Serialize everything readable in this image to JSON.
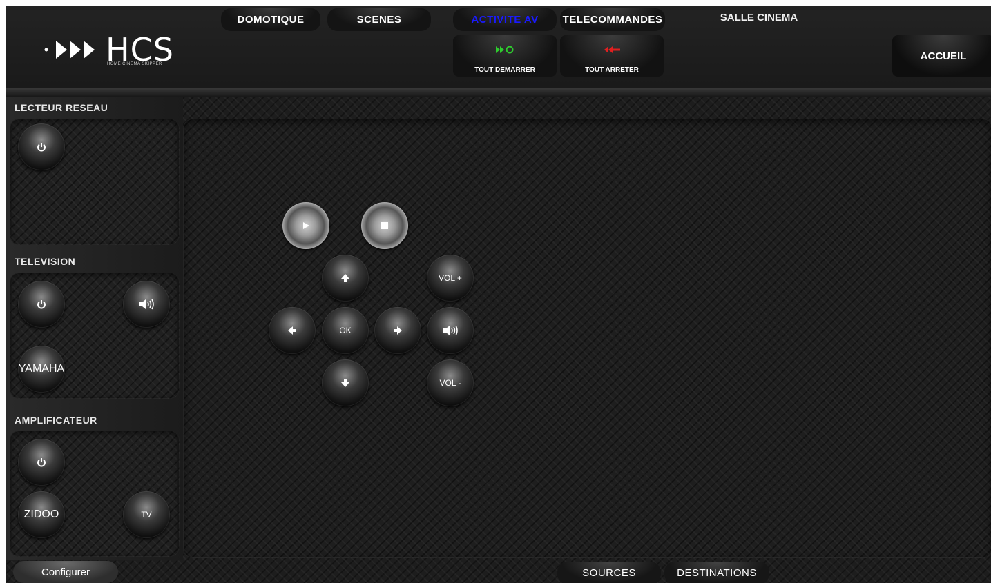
{
  "header": {
    "logo_text": "HCS",
    "logo_subtitle": "HOME CINEMA SKIPPER",
    "tabs": [
      {
        "label": "DOMOTIQUE"
      },
      {
        "label": "SCENES"
      },
      {
        "label": "ACTIVITE AV"
      },
      {
        "label": "TELECOMMANDES"
      }
    ],
    "active_tab": "ACTIVITE AV",
    "room_title": "SALLE CINEMA",
    "start_all_label": "TOUT DEMARRER",
    "stop_all_label": "TOUT ARRETER",
    "home_label": "ACCUEIL"
  },
  "sections": {
    "network_player": {
      "title": "LECTEUR RESEAU"
    },
    "television": {
      "title": "TELEVISION",
      "source_label": "YAMAHA"
    },
    "amplifier": {
      "title": "AMPLIFICATEUR",
      "source1_label": "ZIDOO",
      "source2_label": "TV"
    }
  },
  "remote": {
    "ok_label": "OK",
    "vol_up_label": "VOL +",
    "vol_down_label": "VOL -"
  },
  "footer": {
    "configure_label": "Configurer",
    "sources_label": "SOURCES",
    "destinations_label": "DESTINATIONS"
  },
  "colors": {
    "active_tab": "#1a1aff",
    "start_all_icon": "#2ecc2e",
    "stop_all_icon": "#e02020"
  }
}
